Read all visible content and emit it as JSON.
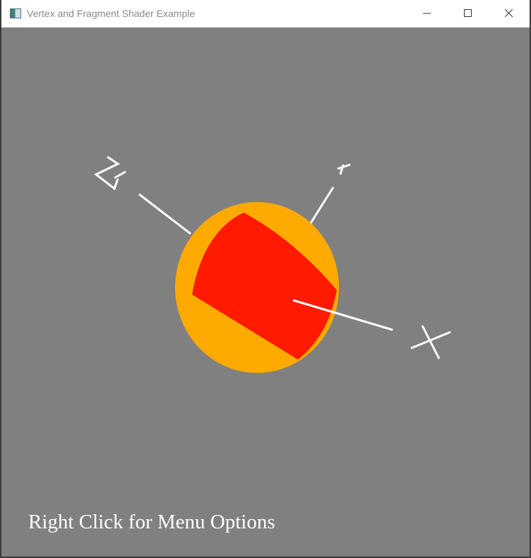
{
  "window": {
    "title": "Vertex and Fragment Shader Example",
    "app_icon": "opengl-window-icon",
    "controls": {
      "minimize": "minimize-icon",
      "maximize": "maximize-icon",
      "close": "close-icon"
    }
  },
  "scene": {
    "background_color": "#808080",
    "sphere_color": "#FFAA00",
    "cube_color": "#FF1A00",
    "axis_color": "#FFFFFF",
    "axes": [
      "X",
      "Y",
      "Z"
    ]
  },
  "hint": {
    "text": "Right Click for Menu Options"
  }
}
